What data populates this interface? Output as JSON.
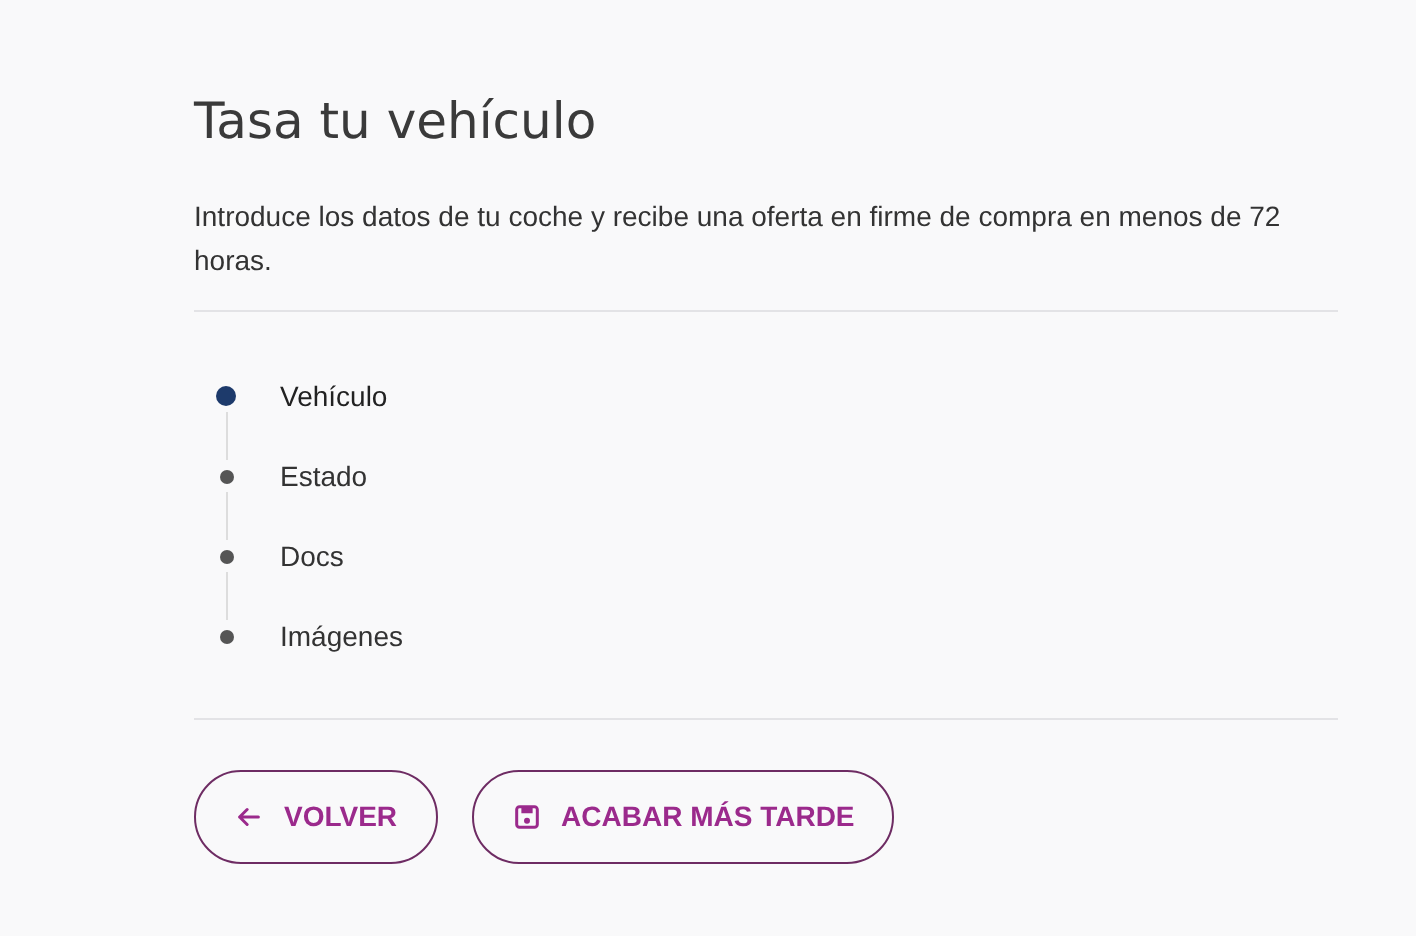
{
  "title": "Tasa tu vehículo",
  "description": "Introduce los datos de tu coche y recibe una oferta en firme de compra en menos de 72 horas.",
  "steps": [
    {
      "label": "Vehículo",
      "selected": true
    },
    {
      "label": "Estado",
      "selected": false
    },
    {
      "label": "Docs",
      "selected": false
    },
    {
      "label": "Imágenes",
      "selected": false
    }
  ],
  "buttons": [
    {
      "label": "VOLVER",
      "kind": "back"
    },
    {
      "label": "ACABAR MÁS TARDE",
      "kind": "save"
    }
  ]
}
